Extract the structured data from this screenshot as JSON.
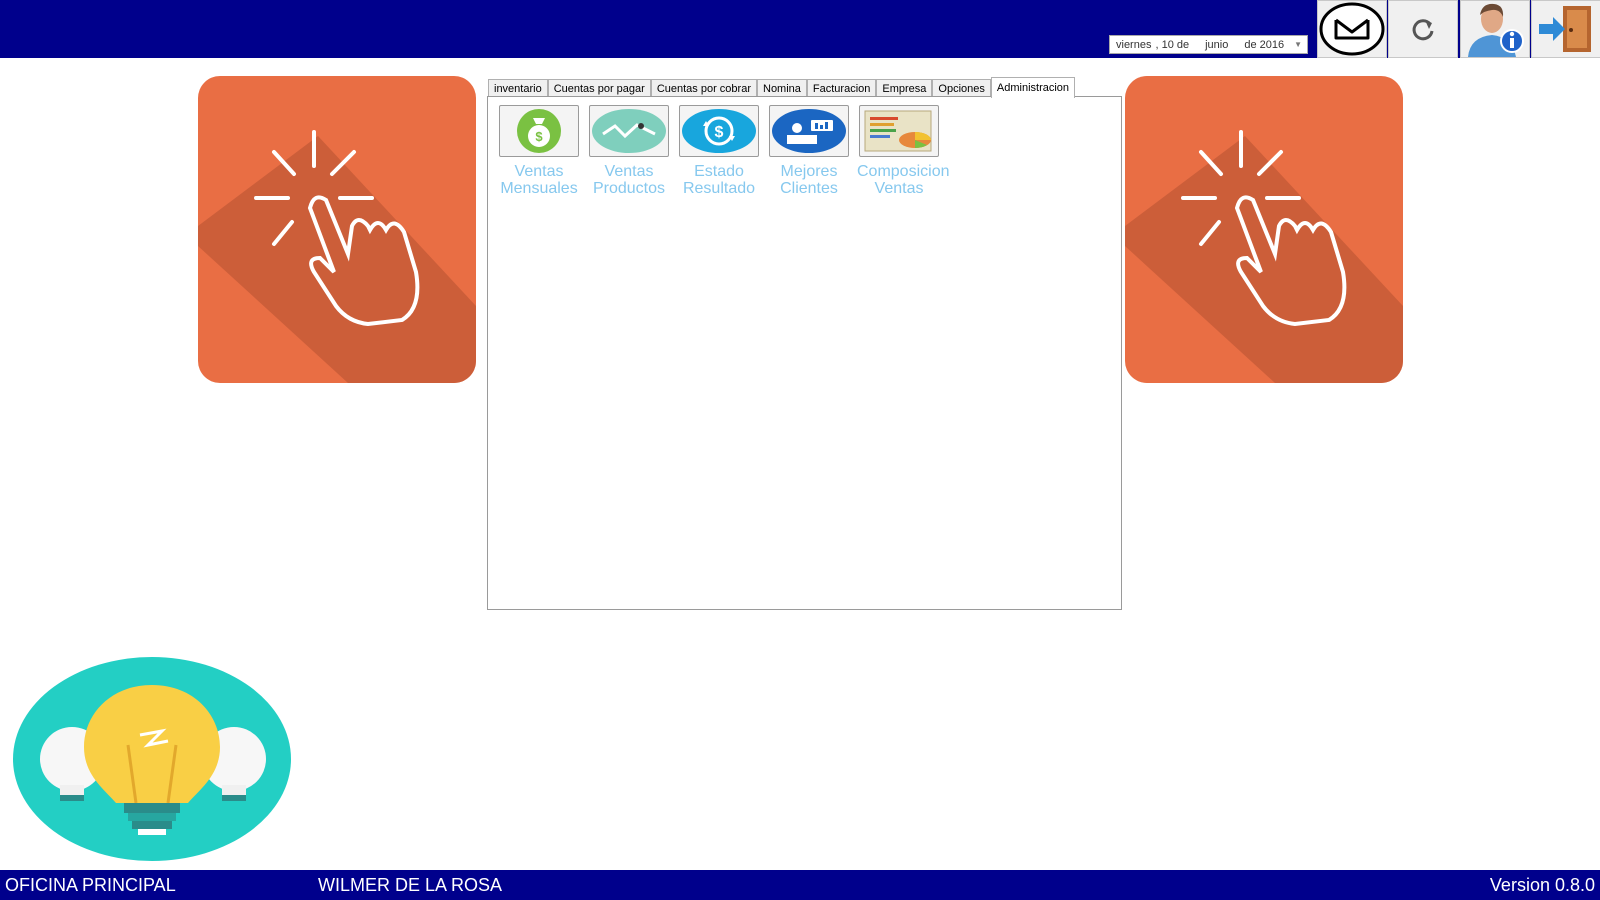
{
  "header": {
    "date": {
      "weekday": "viernes",
      "day_text": ", 10 de",
      "month": "junio",
      "year_text": "de 2016"
    },
    "buttons": [
      {
        "name": "mail-button",
        "icon": "envelope-icon"
      },
      {
        "name": "refresh-button",
        "icon": "refresh-icon"
      },
      {
        "name": "user-info-button",
        "icon": "user-info-icon"
      },
      {
        "name": "exit-button",
        "icon": "exit-door-icon"
      }
    ]
  },
  "tabs": [
    "inventario",
    "Cuentas por pagar",
    "Cuentas por cobrar",
    "Nomina",
    "Facturacion",
    "Empresa",
    "Opciones",
    "Administracion"
  ],
  "active_tab": "Administracion",
  "tools": [
    {
      "line1": "Ventas",
      "line2": "Mensuales",
      "icon": "money-bag-icon"
    },
    {
      "line1": "Ventas",
      "line2": "Productos",
      "icon": "trend-line-icon"
    },
    {
      "line1": "Estado",
      "line2": "Resultado",
      "icon": "dollar-exchange-icon"
    },
    {
      "line1": "Mejores",
      "line2": "Clientes",
      "icon": "client-desk-icon"
    },
    {
      "line1": "Composicion",
      "line2": "Ventas",
      "icon": "pie-report-icon"
    }
  ],
  "footer": {
    "office": "OFICINA PRINCIPAL",
    "user": "WILMER DE LA ROSA",
    "version": "Version 0.8.0"
  },
  "colors": {
    "header_bg": "#00008c",
    "panel_orange": "#e96e44",
    "idea_teal": "#23cfc4",
    "label_blue": "#86c8ee"
  }
}
